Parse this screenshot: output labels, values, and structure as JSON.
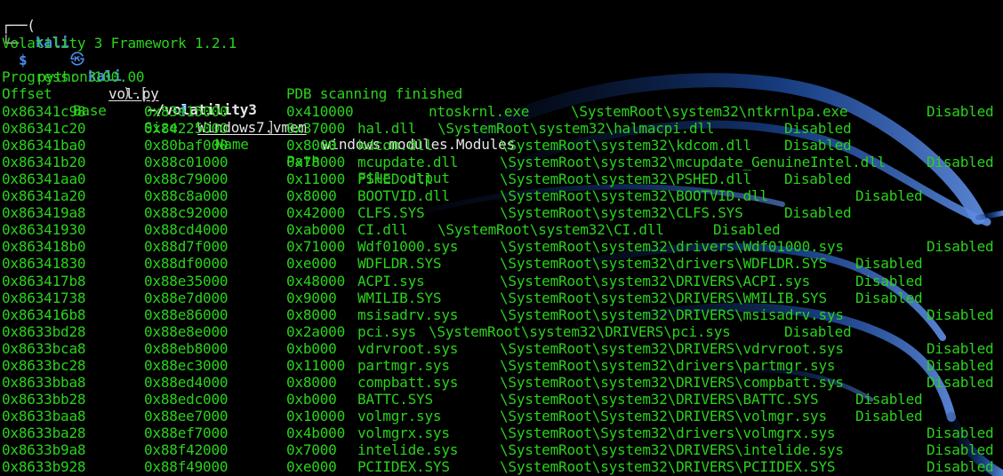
{
  "prompt": {
    "corner_top": "┌──(",
    "user": "kali",
    "skull": "㉿",
    "host": "kali",
    "sep": ")-[",
    "path": "~/volatility3",
    "close": "]",
    "corner_bottom": "└─",
    "symbol": "$"
  },
  "command": {
    "program": "python3",
    "script": "vol.py",
    "flag": "-f",
    "image": "Windows7.vmem",
    "plugin": "windows.modules.Modules"
  },
  "output": {
    "banner": "Volatility 3 Framework 1.2.1",
    "progress_label": "Progress:  100.00",
    "progress_value": 100.0,
    "pdb_status": "PDB scanning finished"
  },
  "table": {
    "headers": [
      "Offset",
      "Base",
      "Size",
      "Name",
      "Path",
      "File output"
    ],
    "rows": [
      {
        "offset": "0x86341c98",
        "base": "0x83e15000",
        "size": "0x410000",
        "name": "ntoskrnl.exe",
        "path": "\\SystemRoot\\system32\\ntkrnlpa.exe",
        "file_output": "Disabled"
      },
      {
        "offset": "0x86341c20",
        "base": "0x84225000",
        "size": "0x37000",
        "name": "hal.dll",
        "path": "\\SystemRoot\\system32\\halmacpi.dll",
        "file_output": "Disabled"
      },
      {
        "offset": "0x86341ba0",
        "base": "0x80baf000",
        "size": "0x8000",
        "name": "kdcom.dll",
        "path": "\\SystemRoot\\system32\\kdcom.dll",
        "file_output": "Disabled"
      },
      {
        "offset": "0x86341b20",
        "base": "0x88c01000",
        "size": "0x78000",
        "name": "mcupdate.dll",
        "path": "\\SystemRoot\\system32\\mcupdate_GenuineIntel.dll",
        "file_output": "Disabled"
      },
      {
        "offset": "0x86341aa0",
        "base": "0x88c79000",
        "size": "0x11000",
        "name": "PSHED.dll",
        "path": "\\SystemRoot\\system32\\PSHED.dll",
        "file_output": "Disabled"
      },
      {
        "offset": "0x86341a20",
        "base": "0x88c8a000",
        "size": "0x8000",
        "name": "BOOTVID.dll",
        "path": "\\SystemRoot\\system32\\BOOTVID.dll",
        "file_output": "Disabled"
      },
      {
        "offset": "0x863419a8",
        "base": "0x88c92000",
        "size": "0x42000",
        "name": "CLFS.SYS",
        "path": "\\SystemRoot\\system32\\CLFS.SYS",
        "file_output": "Disabled"
      },
      {
        "offset": "0x86341930",
        "base": "0x88cd4000",
        "size": "0xab000",
        "name": "CI.dll",
        "path": "\\SystemRoot\\system32\\CI.dll",
        "file_output": "Disabled"
      },
      {
        "offset": "0x863418b0",
        "base": "0x88d7f000",
        "size": "0x71000",
        "name": "Wdf01000.sys",
        "path": "\\SystemRoot\\system32\\drivers\\Wdf01000.sys",
        "file_output": "Disabled"
      },
      {
        "offset": "0x86341830",
        "base": "0x88df0000",
        "size": "0xe000",
        "name": "WDFLDR.SYS",
        "path": "\\SystemRoot\\system32\\drivers\\WDFLDR.SYS",
        "file_output": "Disabled"
      },
      {
        "offset": "0x863417b8",
        "base": "0x88e35000",
        "size": "0x48000",
        "name": "ACPI.sys",
        "path": "\\SystemRoot\\system32\\DRIVERS\\ACPI.sys",
        "file_output": "Disabled"
      },
      {
        "offset": "0x86341738",
        "base": "0x88e7d000",
        "size": "0x9000",
        "name": "WMILIB.SYS",
        "path": "\\SystemRoot\\system32\\DRIVERS\\WMILIB.SYS",
        "file_output": "Disabled"
      },
      {
        "offset": "0x863416b8",
        "base": "0x88e86000",
        "size": "0x8000",
        "name": "msisadrv.sys",
        "path": "\\SystemRoot\\system32\\DRIVERS\\msisadrv.sys",
        "file_output": "Disabled"
      },
      {
        "offset": "0x8633bd28",
        "base": "0x88e8e000",
        "size": "0x2a000",
        "name": "pci.sys",
        "path": "\\SystemRoot\\system32\\DRIVERS\\pci.sys",
        "file_output": "Disabled"
      },
      {
        "offset": "0x8633bca8",
        "base": "0x88eb8000",
        "size": "0xb000",
        "name": "vdrvroot.sys",
        "path": "\\SystemRoot\\system32\\DRIVERS\\vdrvroot.sys",
        "file_output": "Disabled"
      },
      {
        "offset": "0x8633bc28",
        "base": "0x88ec3000",
        "size": "0x11000",
        "name": "partmgr.sys",
        "path": "\\SystemRoot\\system32\\drivers\\partmgr.sys",
        "file_output": "Disabled"
      },
      {
        "offset": "0x8633bba8",
        "base": "0x88ed4000",
        "size": "0x8000",
        "name": "compbatt.sys",
        "path": "\\SystemRoot\\system32\\DRIVERS\\compbatt.sys",
        "file_output": "Disabled"
      },
      {
        "offset": "0x8633bb28",
        "base": "0x88edc000",
        "size": "0xb000",
        "name": "BATTC.SYS",
        "path": "\\SystemRoot\\system32\\DRIVERS\\BATTC.SYS",
        "file_output": "Disabled"
      },
      {
        "offset": "0x8633baa8",
        "base": "0x88ee7000",
        "size": "0x10000",
        "name": "volmgr.sys",
        "path": "\\SystemRoot\\System32\\DRIVERS\\volmgr.sys",
        "file_output": "Disabled"
      },
      {
        "offset": "0x8633ba28",
        "base": "0x88ef7000",
        "size": "0x4b000",
        "name": "volmgrx.sys",
        "path": "\\SystemRoot\\System32\\drivers\\volmgrx.sys",
        "file_output": "Disabled"
      },
      {
        "offset": "0x8633b9a8",
        "base": "0x88f42000",
        "size": "0x7000",
        "name": "intelide.sys",
        "path": "\\SystemRoot\\system32\\DRIVERS\\intelide.sys",
        "file_output": "Disabled"
      },
      {
        "offset": "0x8633b928",
        "base": "0x88f49000",
        "size": "0xe000",
        "name": "PCIIDEX.SYS",
        "path": "\\SystemRoot\\system32\\DRIVERS\\PCIIDEX.SYS",
        "file_output": "Disabled"
      }
    ]
  },
  "colors": {
    "background": "#000000",
    "text": "#2bd21c",
    "prompt_accent": "#4a8cf0",
    "wallpaper_dragon": "#1b4a9a"
  }
}
